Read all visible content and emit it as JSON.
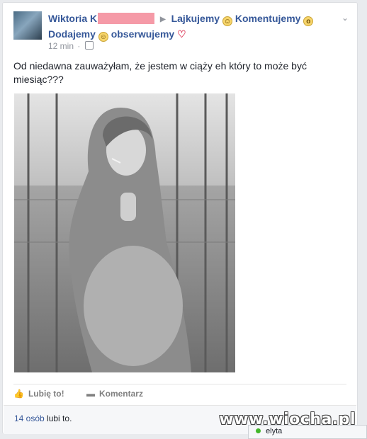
{
  "post": {
    "author_first": "Wiktoria K",
    "links": [
      {
        "label": "Lajkujemy"
      },
      {
        "label": "Komentujemy"
      },
      {
        "label": "Dodajemy"
      },
      {
        "label": "obserwujemy"
      }
    ],
    "emoji": [
      "smile-emoji",
      "surprised-emoji",
      "smile-emoji"
    ],
    "timestamp": "12 min",
    "text": "Od niedawna zauważyłam, że jestem w ciąży eh który to może być miesiąc???",
    "actions": {
      "like": "Lubię to!",
      "comment": "Komentarz"
    },
    "likes": {
      "count": "14 osób",
      "suffix": "lubi to."
    }
  },
  "chat": {
    "name": "elyta",
    "status_color": "#42b72a"
  },
  "watermark": "www.wiocha.pl",
  "colors": {
    "link": "#365899",
    "meta": "#90949c",
    "redact": "#f59aa7"
  }
}
